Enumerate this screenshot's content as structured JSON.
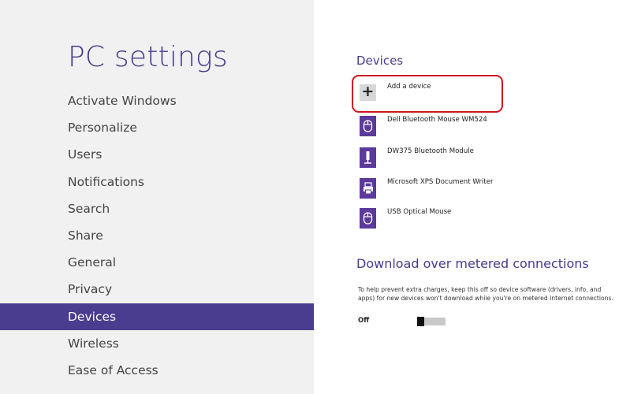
{
  "left_pane": {
    "title": "PC settings",
    "nav_items": [
      {
        "label": "Activate Windows"
      },
      {
        "label": "Personalize"
      },
      {
        "label": "Users"
      },
      {
        "label": "Notifications"
      },
      {
        "label": "Search"
      },
      {
        "label": "Share"
      },
      {
        "label": "General"
      },
      {
        "label": "Privacy"
      },
      {
        "label": "Devices",
        "selected": true
      },
      {
        "label": "Wireless"
      },
      {
        "label": "Ease of Access"
      }
    ]
  },
  "devices_section": {
    "title": "Devices",
    "add_device": {
      "label": "Add a device",
      "icon": "plus-icon"
    },
    "devices": [
      {
        "label": "Dell Bluetooth Mouse WM524",
        "icon": "mouse-icon"
      },
      {
        "label": "DW375 Bluetooth Module",
        "icon": "usb-icon"
      },
      {
        "label": "Microsoft XPS Document Writer",
        "icon": "printer-icon"
      },
      {
        "label": "USB Optical Mouse",
        "icon": "mouse-icon"
      }
    ]
  },
  "download_section": {
    "title": "Download over metered connections",
    "description": "To help prevent extra charges, keep this off so device software (drivers, info, and apps) for new devices won't download while you're on metered Internet connections.",
    "toggle_label": "Off",
    "toggle_on": false
  },
  "colors": {
    "accent": "#4a3c8f",
    "icon_tile": "#5b3a9c",
    "highlight": "#d0161e"
  }
}
